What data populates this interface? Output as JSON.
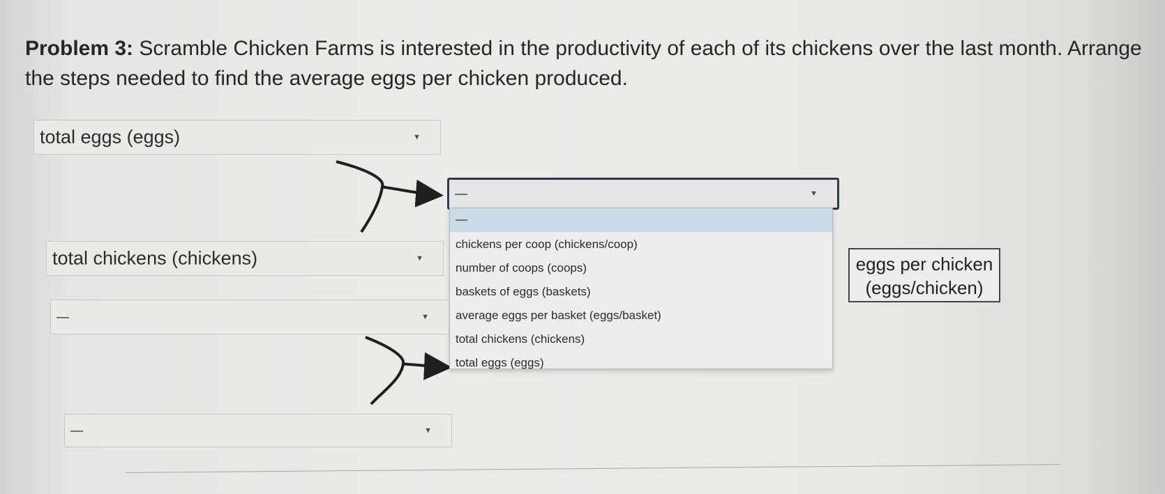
{
  "problem": {
    "lead": "Problem 3:",
    "text": " Scramble Chicken Farms is interested in the productivity of each of its chickens over the last month. Arrange the steps needed to find the average eggs per chicken produced."
  },
  "selects": {
    "first": {
      "value": "total eggs (eggs)"
    },
    "divisor_open": {
      "value": "—"
    },
    "second": {
      "value": "total chickens (chickens)"
    },
    "third": {
      "value": "—"
    },
    "fourth": {
      "value": "—"
    }
  },
  "dropdown": {
    "options": [
      "—",
      "chickens per coop (chickens/coop)",
      "number of coops (coops)",
      "baskets of eggs (baskets)",
      "average eggs per basket (eggs/basket)",
      "total chickens (chickens)",
      "total eggs (eggs)"
    ],
    "highlighted": "—"
  },
  "result": {
    "line1": "eggs per chicken",
    "line2": "(eggs/chicken)"
  },
  "icons": {
    "dropdown_arrow": "▼",
    "connector": "curved-arrow"
  }
}
